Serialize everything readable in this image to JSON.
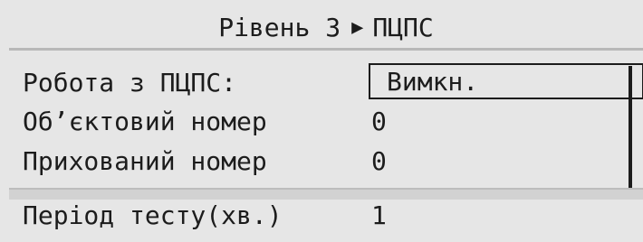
{
  "header": {
    "level": "Рівень 3",
    "arrow": "▶",
    "section": "ПЦПС"
  },
  "menu": {
    "items": [
      {
        "label": "Робота з ПЦПС:",
        "value": "Вимкн."
      },
      {
        "label": "Об’єктовий номер",
        "value": "0"
      },
      {
        "label": "Прихований номер",
        "value": "0"
      },
      {
        "label": "Період тесту(хв.)",
        "value": "1"
      }
    ]
  }
}
